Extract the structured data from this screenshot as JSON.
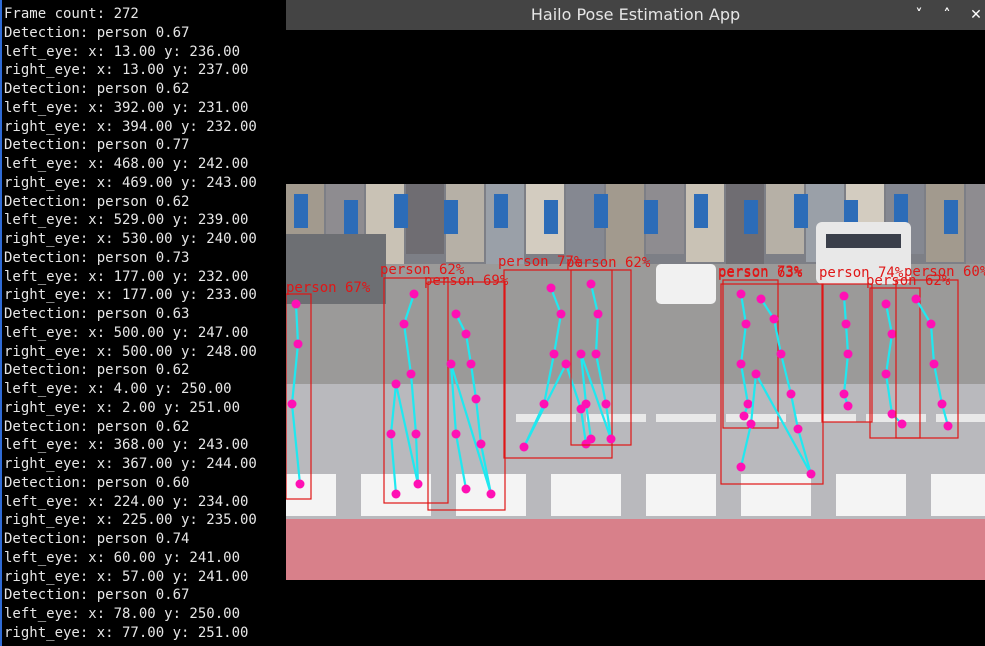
{
  "terminal": {
    "lines": [
      "Frame count: 272",
      "Detection: person 0.67",
      "left_eye: x: 13.00 y: 236.00",
      "right_eye: x: 13.00 y: 237.00",
      "Detection: person 0.62",
      "left_eye: x: 392.00 y: 231.00",
      "right_eye: x: 394.00 y: 232.00",
      "Detection: person 0.77",
      "left_eye: x: 468.00 y: 242.00",
      "right_eye: x: 469.00 y: 243.00",
      "Detection: person 0.62",
      "left_eye: x: 529.00 y: 239.00",
      "right_eye: x: 530.00 y: 240.00",
      "Detection: person 0.73",
      "left_eye: x: 177.00 y: 232.00",
      "right_eye: x: 177.00 y: 233.00",
      "Detection: person 0.63",
      "left_eye: x: 500.00 y: 247.00",
      "right_eye: x: 500.00 y: 248.00",
      "Detection: person 0.62",
      "left_eye: x: 4.00 y: 250.00",
      "right_eye: x: 2.00 y: 251.00",
      "Detection: person 0.62",
      "left_eye: x: 368.00 y: 243.00",
      "right_eye: x: 367.00 y: 244.00",
      "Detection: person 0.60",
      "left_eye: x: 224.00 y: 234.00",
      "right_eye: x: 225.00 y: 235.00",
      "Detection: person 0.74",
      "left_eye: x: 60.00 y: 241.00",
      "right_eye: x: 57.00 y: 241.00",
      "Detection: person 0.67",
      "left_eye: x: 78.00 y: 250.00",
      "right_eye: x: 77.00 y: 251.00"
    ]
  },
  "window": {
    "title": "Hailo Pose Estimation App",
    "buttons": {
      "minimize": "˅",
      "maximize": "˄",
      "close": "✕"
    }
  },
  "video": {
    "colors": {
      "box": "#e01616",
      "skeleton": "#20e8f0",
      "joint": "#ff10b4",
      "road": "#b9b9bd",
      "crosswalk": "#f4f4f4",
      "sidewalk": "#d8808a"
    },
    "detections": [
      {
        "label": "person 67%"
      },
      {
        "label": "person 62%"
      },
      {
        "label": "person 69%"
      },
      {
        "label": "person 77%"
      },
      {
        "label": "person 62%"
      },
      {
        "label": "person 73%"
      },
      {
        "label": "person 63%"
      },
      {
        "label": "person 74%"
      },
      {
        "label": "person 62%"
      },
      {
        "label": "person 60%"
      }
    ]
  }
}
